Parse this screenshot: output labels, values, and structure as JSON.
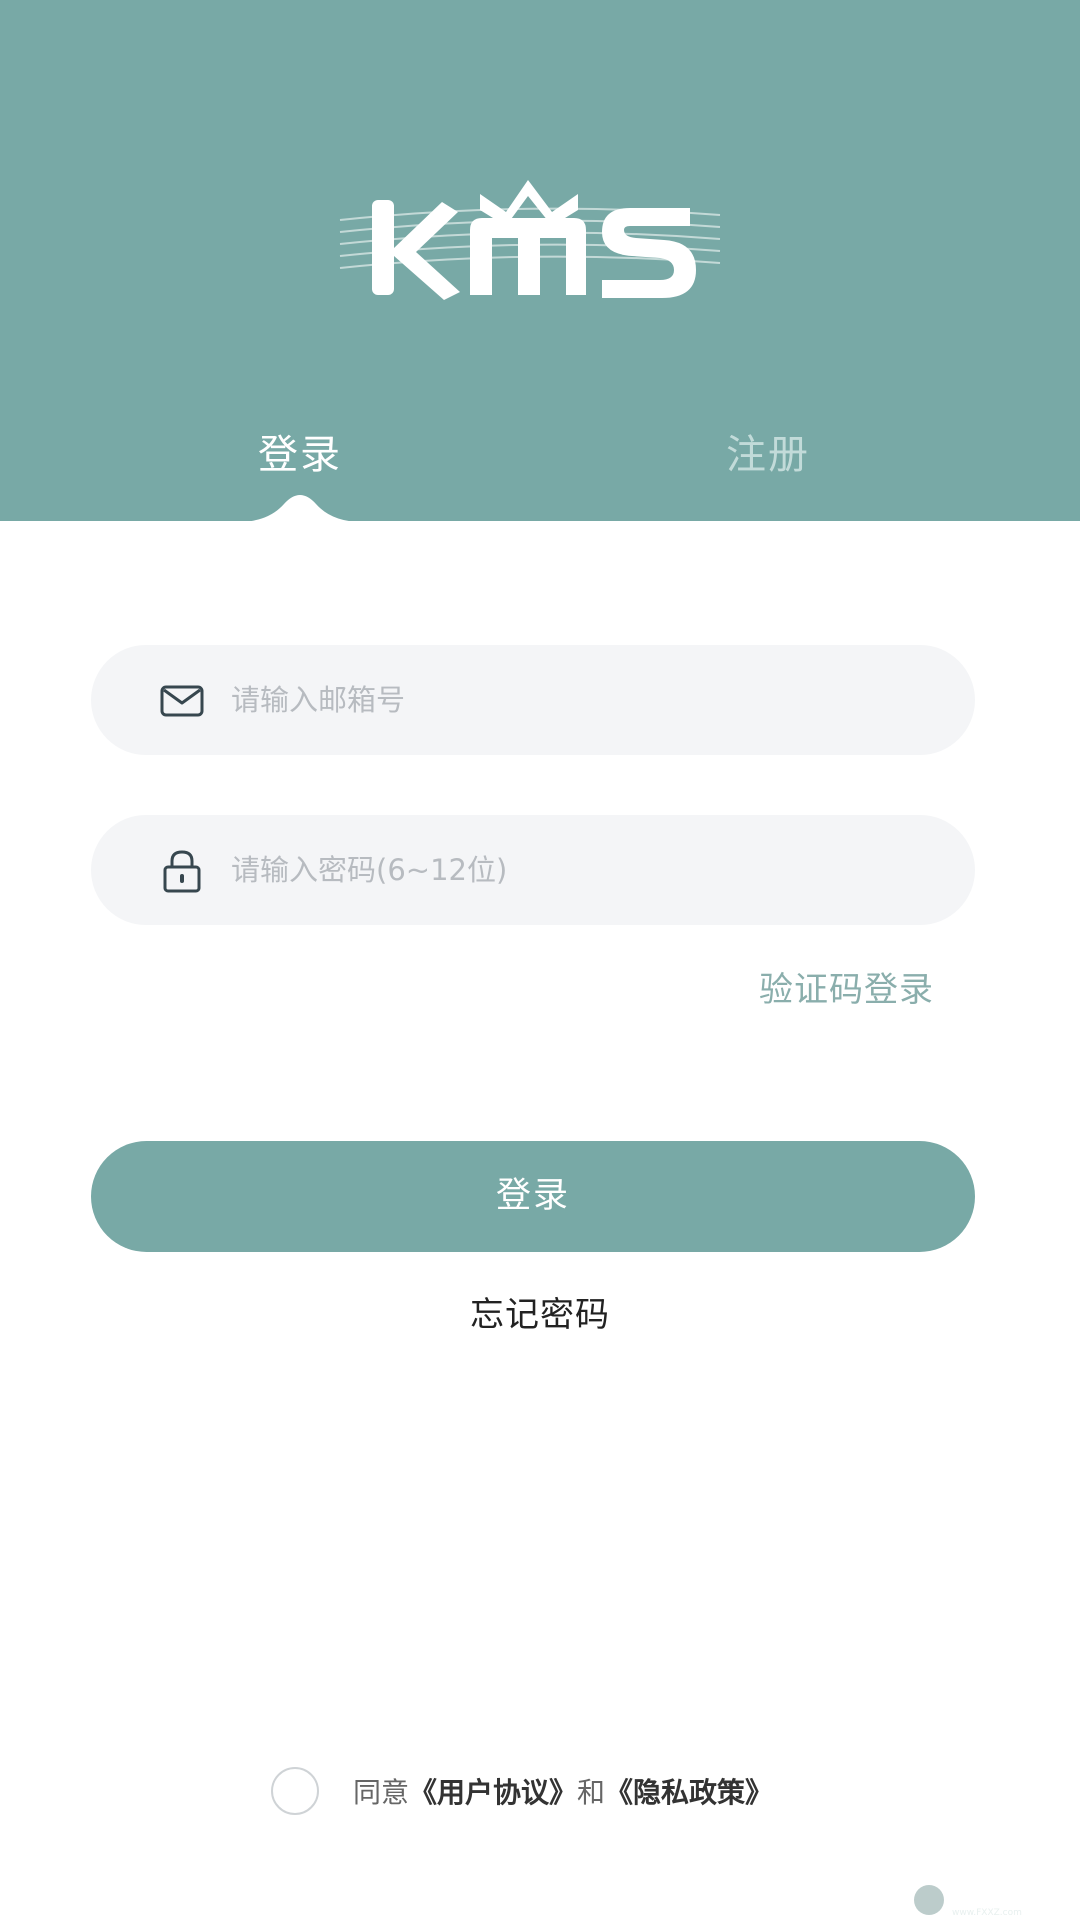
{
  "header": {
    "logo_text": "KMS",
    "tabs": [
      {
        "label": "登录",
        "active": true
      },
      {
        "label": "注册",
        "active": false
      }
    ]
  },
  "form": {
    "email": {
      "icon": "mail-icon",
      "placeholder": "请输入邮箱号",
      "value": ""
    },
    "password": {
      "icon": "lock-icon",
      "placeholder": "请输入密码(6~12位)",
      "value": ""
    },
    "code_login_label": "验证码登录",
    "login_button_label": "登录",
    "forgot_label": "忘记密码"
  },
  "agreement": {
    "checked": false,
    "prefix": "同意",
    "user_agreement": "《用户协议》",
    "conjunction": "和",
    "privacy_policy": "《隐私政策》"
  },
  "watermark": {
    "text": "飞翔下载",
    "url_text": "www.FXXZ.com"
  },
  "colors": {
    "brand": "#78a9a6",
    "field_bg": "#f4f5f7",
    "placeholder": "#b7bbc0",
    "inactive_tab": "#c2dbd9"
  }
}
